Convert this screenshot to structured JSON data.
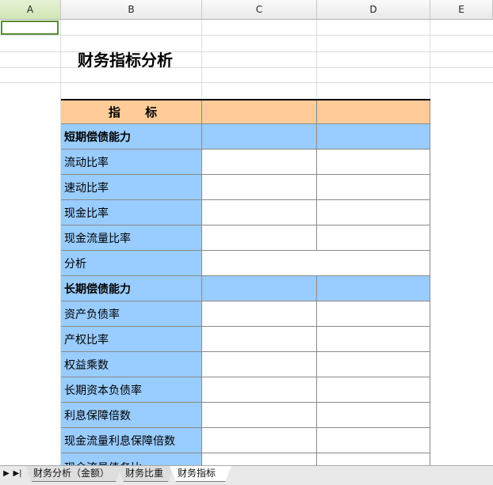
{
  "columns": [
    "A",
    "B",
    "C",
    "D",
    "E"
  ],
  "sheet": {
    "title": "财务指标分析",
    "header_label": "指      标",
    "rows": [
      {
        "label": "短期偿债能力",
        "kind": "section"
      },
      {
        "label": "流动比率",
        "kind": "item"
      },
      {
        "label": "速动比率",
        "kind": "item"
      },
      {
        "label": "现金比率",
        "kind": "item"
      },
      {
        "label": "现金流量比率",
        "kind": "item"
      },
      {
        "label": "分析",
        "kind": "analysis"
      },
      {
        "label": "长期偿债能力",
        "kind": "section"
      },
      {
        "label": "资产负债率",
        "kind": "item"
      },
      {
        "label": "产权比率",
        "kind": "item"
      },
      {
        "label": "权益乘数",
        "kind": "item"
      },
      {
        "label": "长期资本负债率",
        "kind": "item"
      },
      {
        "label": "利息保障倍数",
        "kind": "item"
      },
      {
        "label": "现金流量利息保障倍数",
        "kind": "item"
      },
      {
        "label": "现金流量债务比",
        "kind": "item"
      }
    ]
  },
  "tabs": {
    "nav_last": "▶|",
    "items": [
      {
        "label": "财务分析（金额）",
        "active": false
      },
      {
        "label": "财务比重",
        "active": false
      },
      {
        "label": "财务指标",
        "active": true
      }
    ]
  },
  "colors": {
    "header_fill": "#ffcc99",
    "label_fill": "#99ccff",
    "selection_border": "#5b8c34"
  }
}
